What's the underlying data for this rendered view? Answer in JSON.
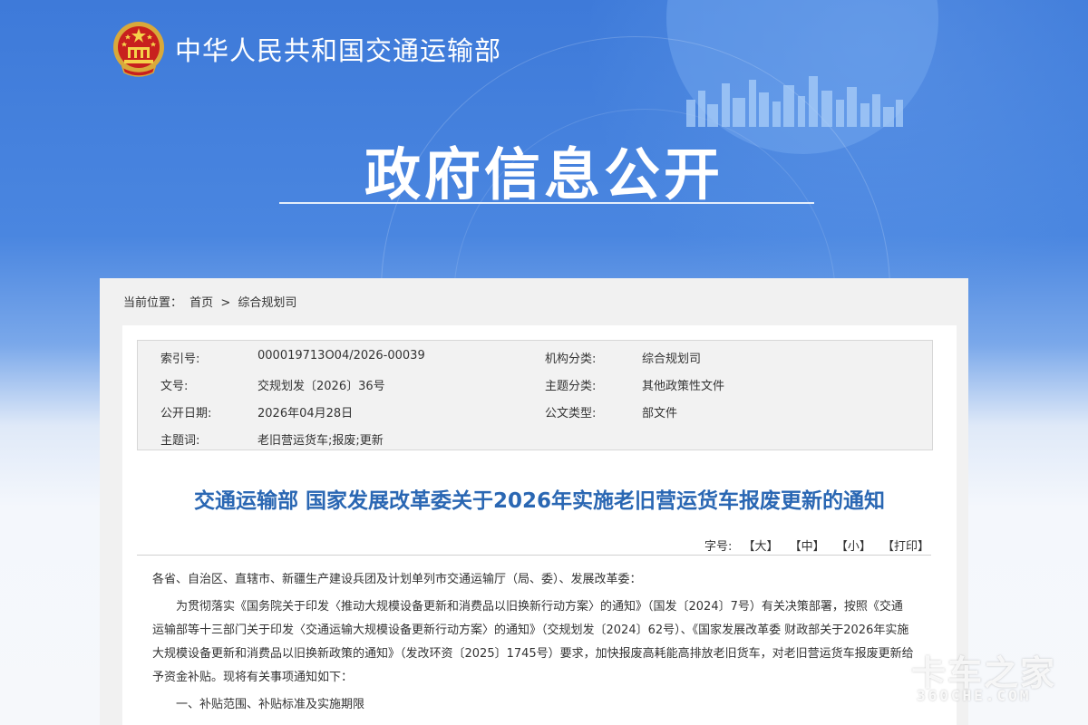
{
  "header": {
    "ministry_name": "中华人民共和国交通运输部",
    "banner_title": "政府信息公开"
  },
  "breadcrumb": {
    "label": "当前位置：",
    "home": "首页",
    "separator": ">",
    "current": "综合规划司"
  },
  "meta": {
    "rows": [
      {
        "k1": "索引号:",
        "v1": "000019713O04/2026-00039",
        "k2": "机构分类:",
        "v2": "综合规划司"
      },
      {
        "k1": "文号:",
        "v1": "交规划发〔2026〕36号",
        "k2": "主题分类:",
        "v2": "其他政策性文件"
      },
      {
        "k1": "公开日期:",
        "v1": "2026年04月28日",
        "k2": "公文类型:",
        "v2": "部文件"
      },
      {
        "k1": "主题词:",
        "v1": "老旧营运货车;报废;更新",
        "k2": "",
        "v2": ""
      }
    ]
  },
  "document": {
    "title": "交通运输部 国家发展改革委关于2026年实施老旧营运货车报废更新的通知",
    "font_size": {
      "label": "字号:",
      "large": "【大】",
      "medium": "【中】",
      "small": "【小】",
      "print": "【打印】"
    },
    "paragraphs": [
      "各省、自治区、直辖市、新疆生产建设兵团及计划单列市交通运输厅（局、委）、发展改革委：",
      "为贯彻落实《国务院关于印发〈推动大规模设备更新和消费品以旧换新行动方案〉的通知》（国发〔2024〕7号）有关决策部署，按照《交通运输部等十三部门关于印发〈交通运输大规模设备更新行动方案〉的通知》（交规划发〔2024〕62号）、《国家发展改革委 财政部关于2026年实施大规模设备更新和消费品以旧换新政策的通知》（发改环资〔2025〕1745号）要求，加快报废高耗能高排放老旧货车，对老旧营运货车报废更新给予资金补贴。现将有关事项通知如下：",
      "一、补贴范围、补贴标准及实施期限"
    ]
  },
  "watermark": {
    "main": "卡车之家",
    "sub": "360CHE.COM"
  },
  "colors": {
    "banner_blue": "#3e7ad9",
    "title_blue": "#2a67b3"
  }
}
